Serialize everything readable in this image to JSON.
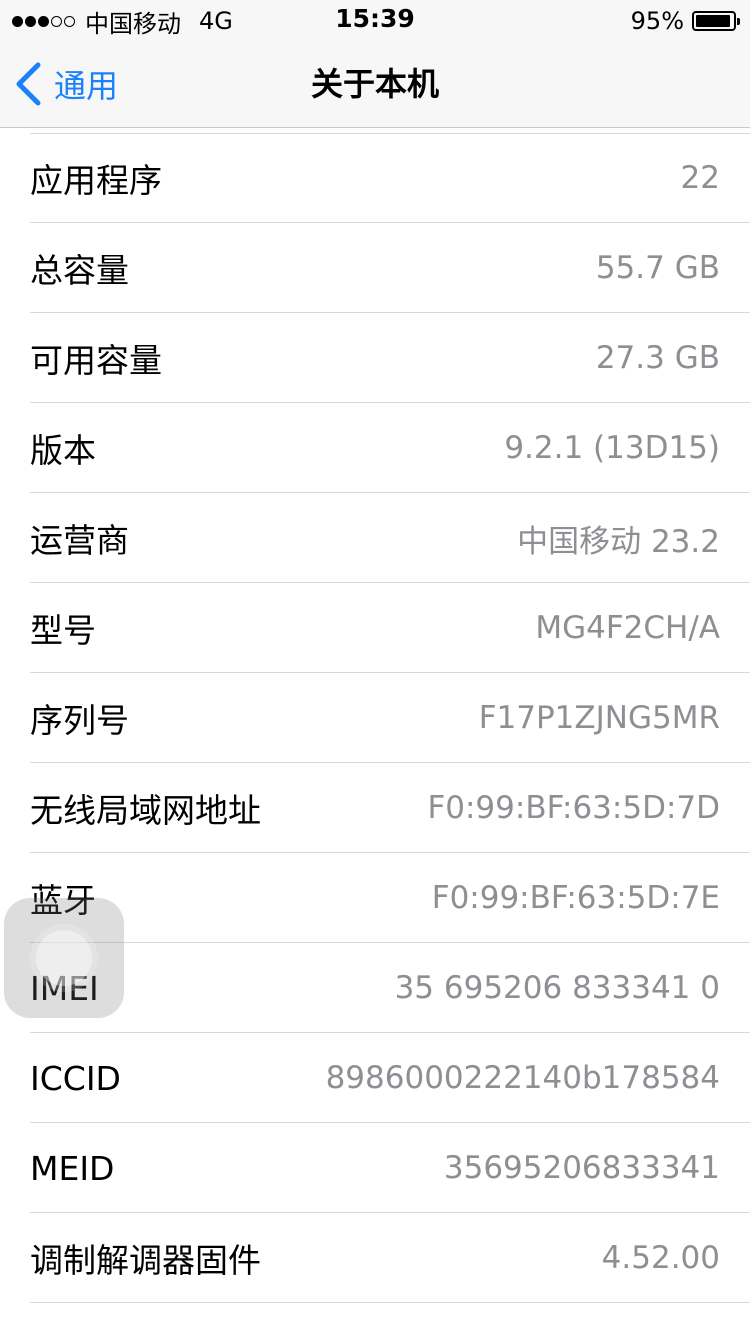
{
  "status_bar": {
    "signal_dots": [
      "full",
      "full",
      "full",
      "empty",
      "empty"
    ],
    "carrier": "中国移动",
    "network": "4G",
    "time": "15:39",
    "battery_percent": "95%",
    "battery_level": 0.95
  },
  "nav": {
    "back_label": "通用",
    "title": "关于本机",
    "accent_color": "#1a82fb"
  },
  "rows": [
    {
      "label": "应用程序",
      "value": "22"
    },
    {
      "label": "总容量",
      "value": "55.7 GB"
    },
    {
      "label": "可用容量",
      "value": "27.3 GB"
    },
    {
      "label": "版本",
      "value": "9.2.1 (13D15)"
    },
    {
      "label": "运营商",
      "value": "中国移动 23.2"
    },
    {
      "label": "型号",
      "value": "MG4F2CH/A"
    },
    {
      "label": "序列号",
      "value": "F17P1ZJNG5MR"
    },
    {
      "label": "无线局域网地址",
      "value": "F0:99:BF:63:5D:7D"
    },
    {
      "label": "蓝牙",
      "value": "F0:99:BF:63:5D:7E"
    },
    {
      "label": "IMEI",
      "value": "35 695206 833341 0"
    },
    {
      "label": "ICCID",
      "value": "8986000222140b178584"
    },
    {
      "label": "MEID",
      "value": "35695206833341"
    },
    {
      "label": "调制解调器固件",
      "value": "4.52.00"
    }
  ]
}
